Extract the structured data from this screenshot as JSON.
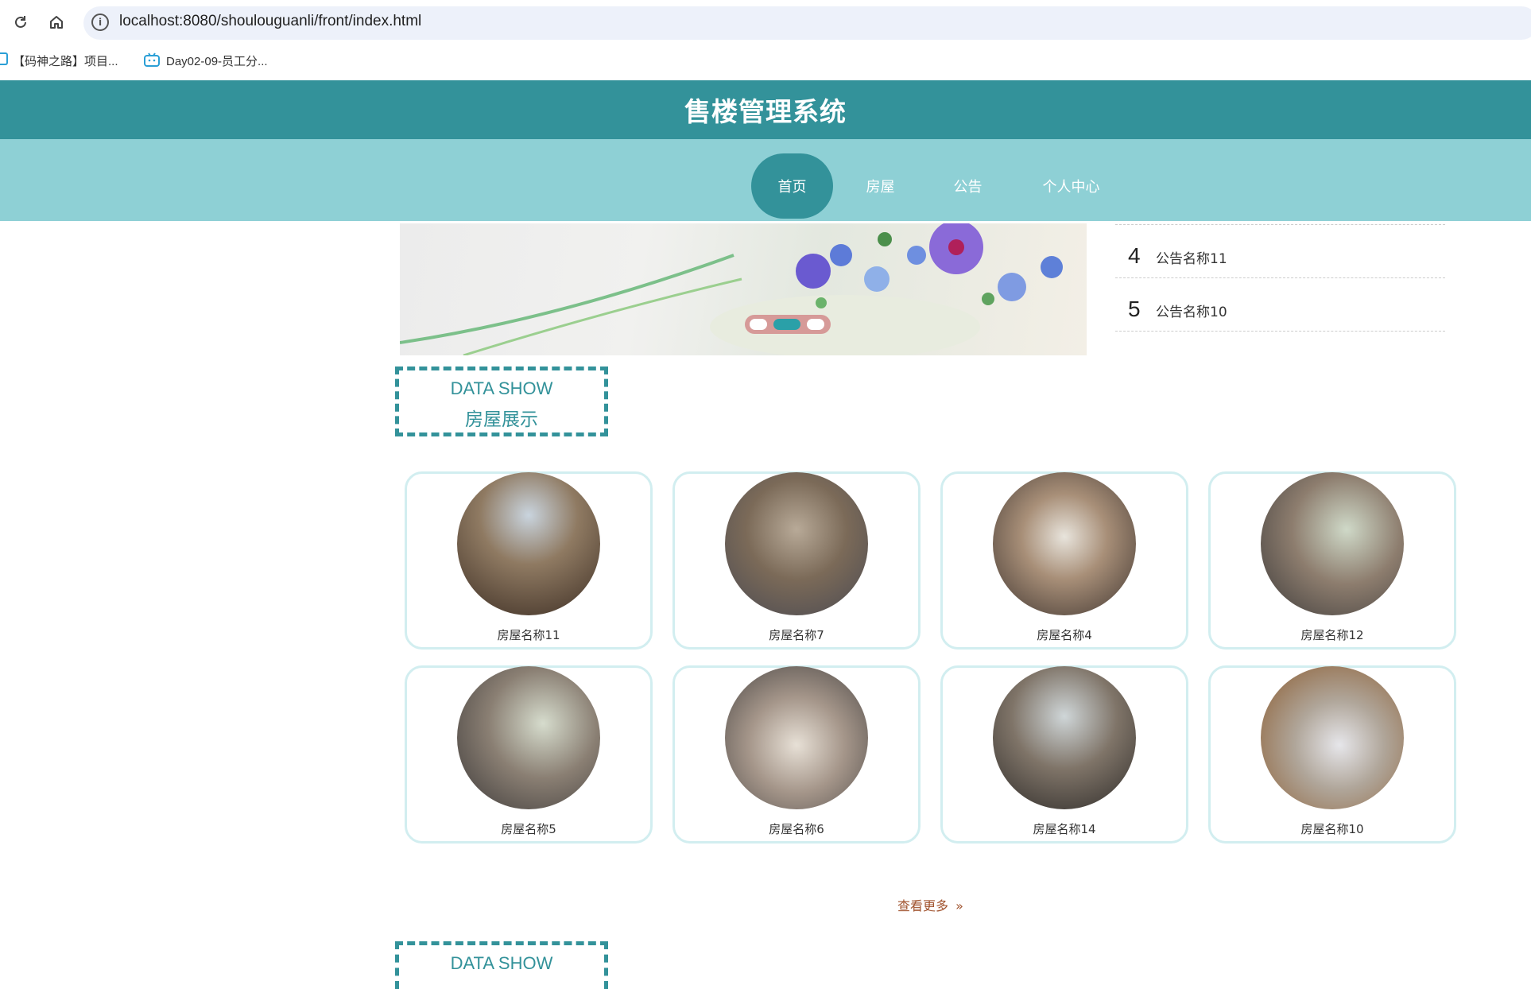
{
  "browser": {
    "url": "localhost:8080/shoulouguanli/front/index.html",
    "bookmarks": [
      {
        "label": "【码神之路】项目..."
      },
      {
        "label": "Day02-09-员工分..."
      }
    ]
  },
  "header": {
    "title": "售楼管理系统"
  },
  "nav": {
    "items": [
      "首页",
      "房屋",
      "公告",
      "个人中心"
    ],
    "active": "首页"
  },
  "notices": [
    {
      "num": "4",
      "title": "公告名称11"
    },
    {
      "num": "5",
      "title": "公告名称10"
    }
  ],
  "section_house": {
    "en": "DATA SHOW",
    "cn": "房屋展示"
  },
  "houses": [
    {
      "name": "房屋名称11"
    },
    {
      "name": "房屋名称7"
    },
    {
      "name": "房屋名称4"
    },
    {
      "name": "房屋名称12"
    },
    {
      "name": "房屋名称5"
    },
    {
      "name": "房屋名称6"
    },
    {
      "name": "房屋名称14"
    },
    {
      "name": "房屋名称10"
    }
  ],
  "more_label": "查看更多",
  "section_next": {
    "en": "DATA SHOW"
  },
  "colors": {
    "primary": "#33929a",
    "nav_bg": "#8ed0d5",
    "card_border": "#d2eef0",
    "more_link": "#a0522d"
  }
}
